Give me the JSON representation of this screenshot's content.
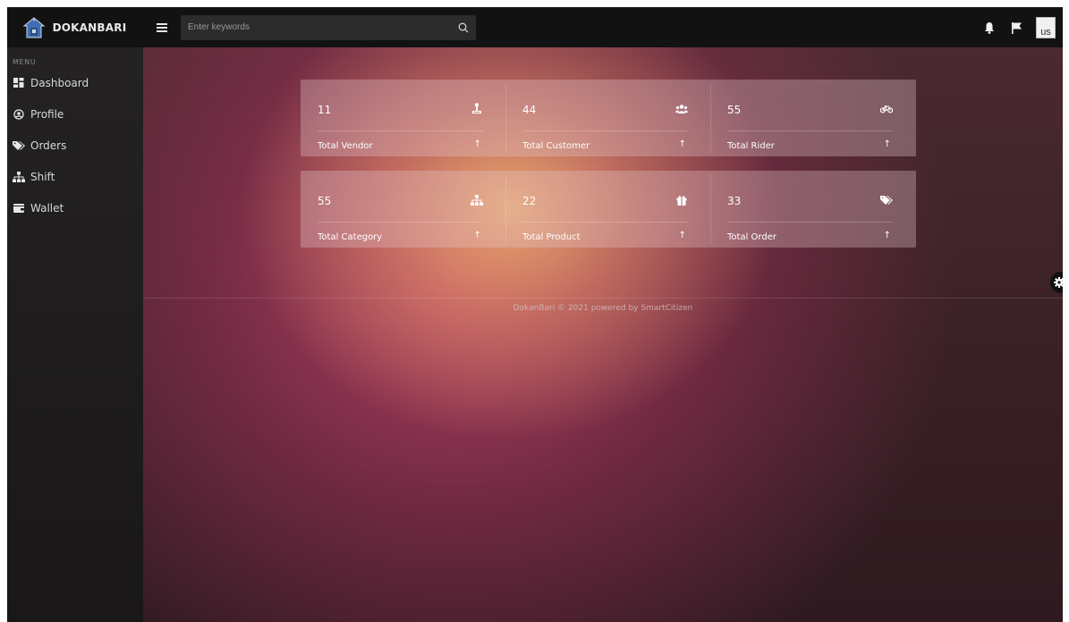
{
  "brand": {
    "name": "DOKANBARI"
  },
  "search": {
    "placeholder": "Enter keywords",
    "value": ""
  },
  "topbar": {
    "avatar_text": "us"
  },
  "sidebar": {
    "heading": "MENU",
    "items": [
      {
        "label": "Dashboard",
        "icon": "dashboard-icon"
      },
      {
        "label": "Profile",
        "icon": "user-circle-icon"
      },
      {
        "label": "Orders",
        "icon": "tags-icon"
      },
      {
        "label": "Shift",
        "icon": "sitemap-icon"
      },
      {
        "label": "Wallet",
        "icon": "wallet-icon"
      }
    ]
  },
  "stats": {
    "row1": [
      {
        "value": "11",
        "label": "Total Vendor",
        "icon": "vendor-icon"
      },
      {
        "value": "44",
        "label": "Total Customer",
        "icon": "users-icon"
      },
      {
        "value": "55",
        "label": "Total Rider",
        "icon": "bicycle-icon"
      }
    ],
    "row2": [
      {
        "value": "55",
        "label": "Total Category",
        "icon": "sitemap-icon"
      },
      {
        "value": "22",
        "label": "Total Product",
        "icon": "gift-icon"
      },
      {
        "value": "33",
        "label": "Total Order",
        "icon": "tags-icon"
      }
    ],
    "arrow": "↑"
  },
  "footer": {
    "text": "DokanBari © 2021 powered by SmartCitizen"
  },
  "colors": {
    "topbar": "#121212",
    "sidebar": "#222021",
    "card_overlay": "#e1c3c8"
  }
}
